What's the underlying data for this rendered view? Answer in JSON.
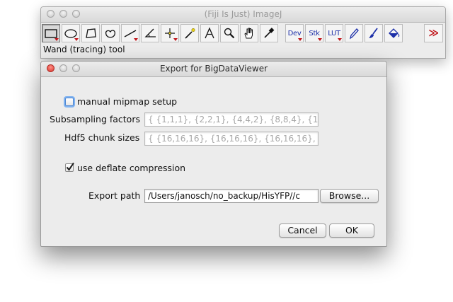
{
  "imagej": {
    "title": "(Fiji Is Just) ImageJ",
    "status": "Wand (tracing) tool",
    "tools": [
      {
        "name": "rectangle-tool-icon"
      },
      {
        "name": "oval-tool-icon"
      },
      {
        "name": "polygon-tool-icon"
      },
      {
        "name": "freehand-tool-icon"
      },
      {
        "name": "line-tool-icon"
      },
      {
        "name": "angle-tool-icon"
      },
      {
        "name": "point-tool-icon"
      },
      {
        "name": "wand-tool-icon"
      },
      {
        "name": "text-tool-icon"
      },
      {
        "name": "magnifier-tool-icon"
      },
      {
        "name": "hand-tool-icon"
      },
      {
        "name": "dropper-tool-icon"
      }
    ],
    "menu_tools": {
      "dev": "Dev",
      "stk": "Stk",
      "lut": "LUT"
    },
    "more_tools": "≫"
  },
  "dialog": {
    "title": "Export for BigDataViewer",
    "manual_mipmap_label": "manual mipmap setup",
    "manual_mipmap_checked": false,
    "subsampling_label": "Subsampling factors",
    "subsampling_value": "{ {1,1,1}, {2,2,1}, {4,4,2}, {8,8,4}, {16,1",
    "chunk_label": "Hdf5 chunk sizes",
    "chunk_value": "{ {16,16,16}, {16,16,16}, {16,16,16}, {1",
    "deflate_label": "use deflate compression",
    "deflate_checked": true,
    "export_path_label": "Export path",
    "export_path_value": "/Users/janosch/no_backup/HisYFP//c",
    "browse_label": "Browse...",
    "cancel_label": "Cancel",
    "ok_label": "OK"
  },
  "colors": {
    "accent_blue": "#1c2fa8",
    "menu_triangle_red": "#c0161b",
    "focus_ring": "#7fb2f0"
  }
}
